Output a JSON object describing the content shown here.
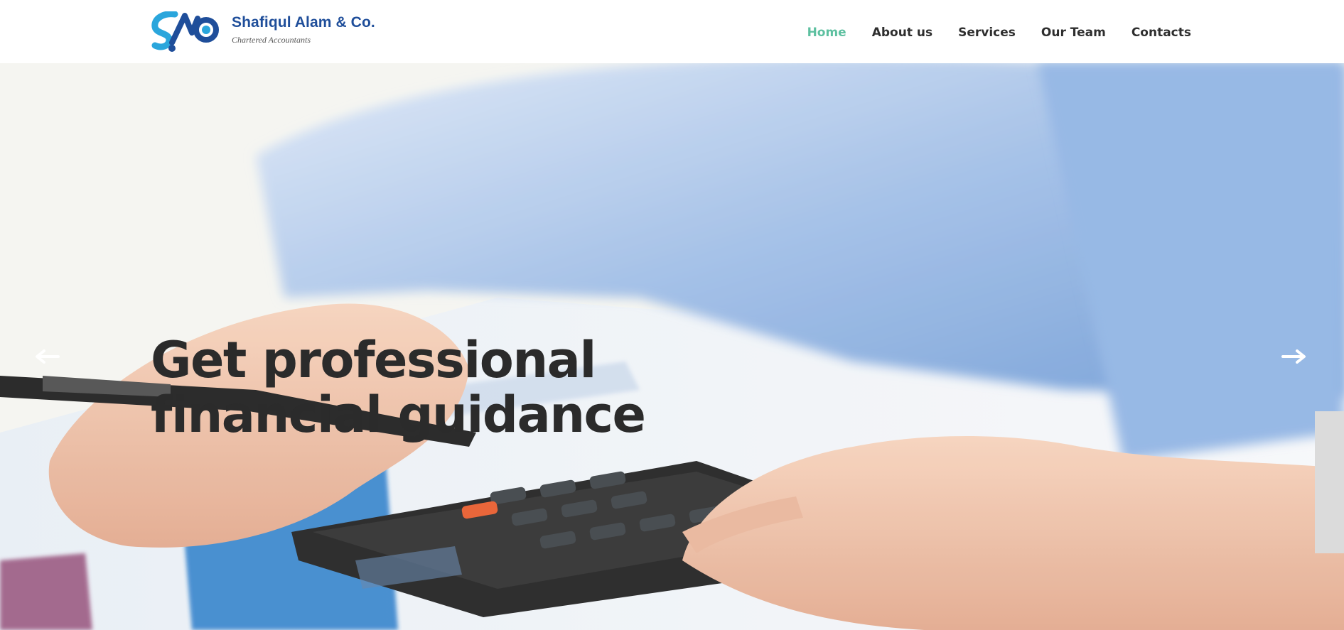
{
  "brand": {
    "name": "Shafiqul Alam & Co.",
    "tagline": "Chartered Accountants",
    "logo_icon": "sac-logo-icon",
    "primary_color": "#1f4e9a",
    "accent_color": "#2aa6dc"
  },
  "nav": {
    "items": [
      {
        "label": "Home",
        "active": true
      },
      {
        "label": "About us",
        "active": false
      },
      {
        "label": "Services",
        "active": false
      },
      {
        "label": "Our Team",
        "active": false
      },
      {
        "label": "Contacts",
        "active": false
      }
    ],
    "active_color": "#5dc0a0"
  },
  "hero": {
    "headline_line1": "Get professional",
    "headline_line2": "financial guidance",
    "prev_icon": "arrow-left-icon",
    "next_icon": "arrow-right-icon"
  }
}
